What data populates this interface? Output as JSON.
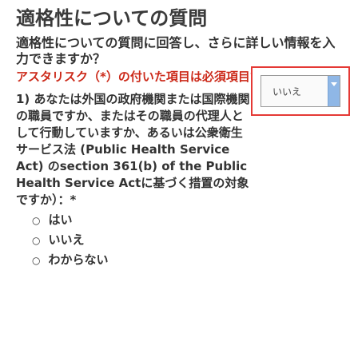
{
  "title": "適格性についての質問",
  "question": "適格性についての質問に回答し、さらに詳しい情報を入力できますか？",
  "required_note": "アスタリスク（*）の付いた項目は必須項目です。",
  "item": {
    "text": "1) あなたは外国の政府機関または国際機関の職員ですか、またはその職員の代理人として行動していますか、あるいは公衆衛生サービス法 (Public Health Service Act) のsection 361(b) of the Public Health Service Actに基づく措置の対象ですか）：*",
    "options": [
      "はい",
      "いいえ",
      "わからない"
    ]
  },
  "select": {
    "value": "いいえ"
  },
  "colors": {
    "required": "#cc2a1a",
    "highlight_border": "#e53935",
    "select_arrow": "#8fb7e6"
  }
}
